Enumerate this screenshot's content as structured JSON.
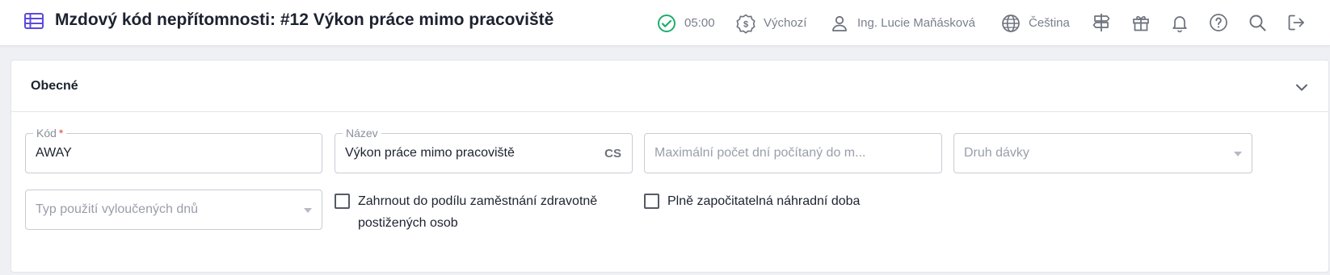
{
  "header": {
    "title": "Mzdový kód nepřítomnosti: #12 Výkon práce mimo pracoviště",
    "status_time": "05:00",
    "budget": "Výchozí",
    "user": "Ing. Lucie Maňásková",
    "language": "Čeština"
  },
  "colors": {
    "accent": "#5b4bdb",
    "status_ok": "#1fae6c",
    "required": "#e04444"
  },
  "icons": [
    "list-icon",
    "clock-check-icon",
    "coin-icon",
    "user-icon",
    "globe-icon",
    "signpost-icon",
    "gift-icon",
    "bell-icon",
    "help-icon",
    "search-icon",
    "logout-icon",
    "chevron-up-icon"
  ],
  "section": {
    "title": "Obecné",
    "fields": {
      "code": {
        "label": "Kód",
        "required_mark": "*",
        "value": "AWAY"
      },
      "name": {
        "label": "Název",
        "value": "Výkon práce mimo pracoviště",
        "lang": "CS"
      },
      "max_days": {
        "placeholder": "Maximální počet dní počítaný do m..."
      },
      "batch_type": {
        "placeholder": "Druh dávky"
      },
      "excluded_days": {
        "placeholder": "Typ použití vyloučených dnů"
      }
    },
    "checkboxes": {
      "disabled_share": {
        "label": "Zahrnout do podílu zaměstnání zdravotně postižených osob",
        "checked": false
      },
      "full_substitute": {
        "label": "Plně započitatelná náhradní doba",
        "checked": false
      }
    }
  }
}
